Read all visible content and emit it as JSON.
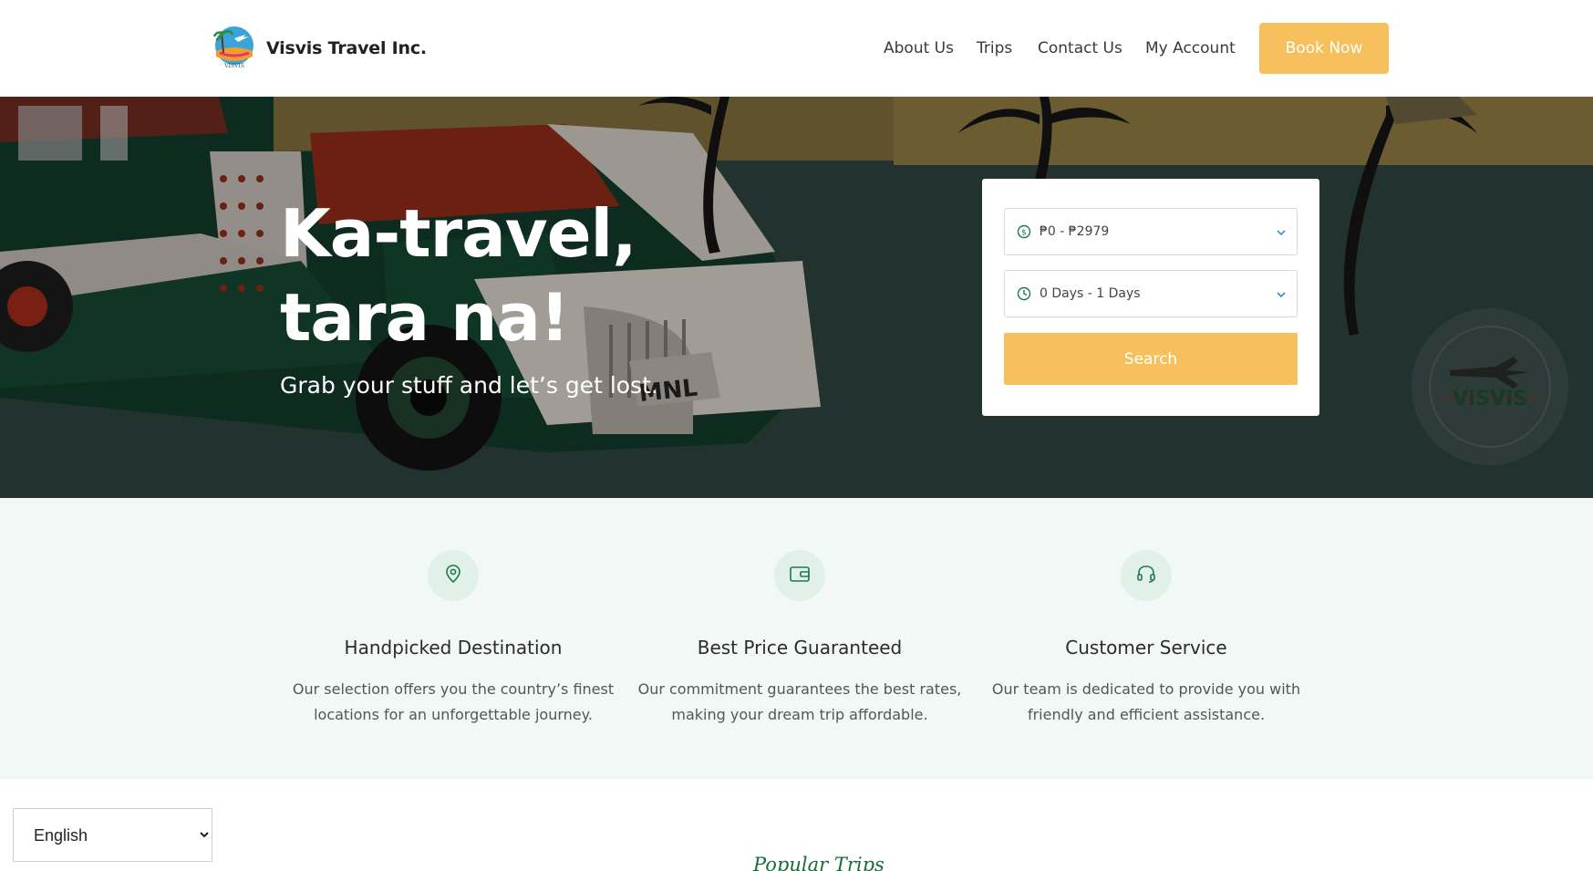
{
  "header": {
    "brand": "Visvis Travel Inc.",
    "nav": [
      "About Us",
      "Trips",
      "Contact Us",
      "My Account"
    ],
    "cta": "Book Now"
  },
  "hero": {
    "title": "Ka-travel, tara na!",
    "subtitle": "Grab your stuff and let’s get lost.",
    "plate_text": "MNL",
    "badge_text": "VISVIS",
    "search": {
      "price_range": "₱0 - ₱2979",
      "duration": "0 Days - 1 Days",
      "button": "Search"
    }
  },
  "features": [
    {
      "icon": "map-pin-icon",
      "title": "Handpicked Destination",
      "desc": "Our selection offers you the country’s finest locations for an unforgettable journey."
    },
    {
      "icon": "wallet-icon",
      "title": "Best Price Guaranteed",
      "desc": "Our commitment guarantees the best rates, making your dream trip affordable."
    },
    {
      "icon": "headset-icon",
      "title": "Customer Service",
      "desc": "Our team is dedicated to provide you with friendly and efficient assistance."
    }
  ],
  "language": {
    "selected": "English"
  },
  "popular_heading": "Popular Trips",
  "colors": {
    "accent": "#f6c15c",
    "green": "#1a6b3a",
    "feature_bg": "#f1f8f6",
    "icon_bg": "#e1f1ea"
  }
}
